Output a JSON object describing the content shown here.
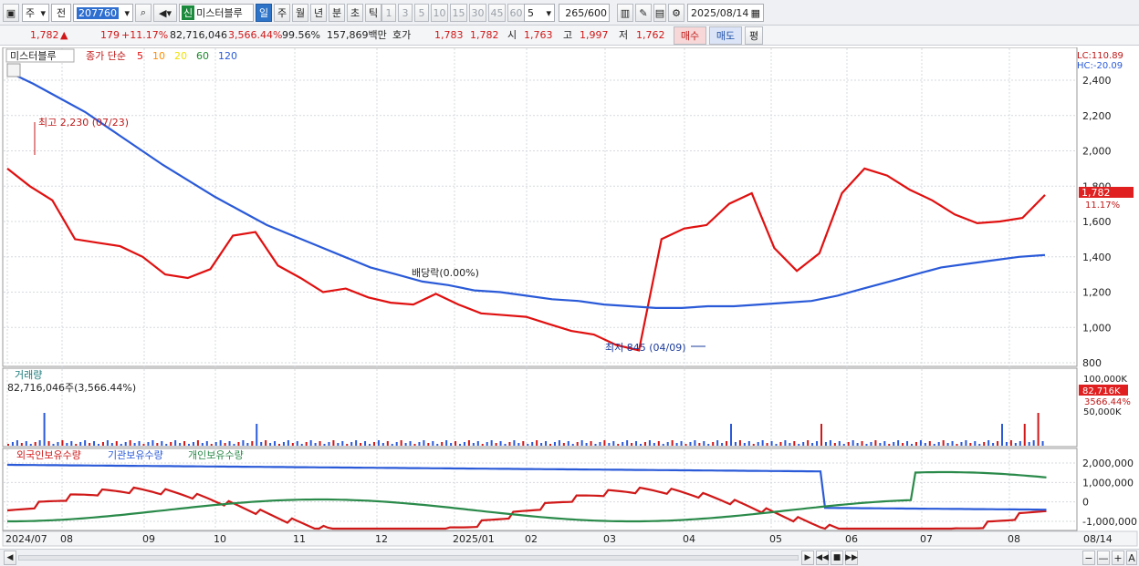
{
  "toolbar": {
    "market": "주",
    "mode": "전",
    "code": "207760",
    "stock_badge": "신",
    "stock_name": "미스터블루",
    "periods": [
      "일",
      "주",
      "월",
      "년",
      "분",
      "초",
      "틱"
    ],
    "active_period": "일",
    "intervals": [
      "1",
      "3",
      "5",
      "10",
      "15",
      "30",
      "45",
      "60"
    ],
    "interval_value": "5",
    "count": "265",
    "count_total": "/600",
    "date": "2025/08/14"
  },
  "infobar": {
    "price": "1,782",
    "arrow": "▲",
    "change": "179",
    "change_pct": "+11.17%",
    "volume": "82,716,046",
    "volume_pct": "3,566.44%",
    "ratio": "99.56%",
    "amount": "157,869백만",
    "hoga_label": "호가",
    "hoga_ask": "1,783",
    "hoga_bid": "1,782",
    "open_label": "시",
    "open": "1,763",
    "high_label": "고",
    "high": "1,997",
    "low_label": "저",
    "low": "1,762",
    "buy": "매수",
    "sell": "매도",
    "flat": "평"
  },
  "price_panel": {
    "name": "미스터블루",
    "ma_title": "종가 단순",
    "mas": [
      "5",
      "10",
      "20",
      "60",
      "120"
    ],
    "ma_colors": [
      "#e01010",
      "#ff8c00",
      "#f0e000",
      "#1a8a2a",
      "#2a5ad8"
    ],
    "lc": "LC:110.89",
    "hc": "HC:-20.09",
    "y_ticks": [
      "2,400",
      "2,200",
      "2,000",
      "1,800",
      "1,600",
      "1,400",
      "1,200",
      "1,000",
      "800"
    ],
    "high_note": "최고 2,230 (07/23)",
    "low_note": "최저 845 (04/09)",
    "dividend_note": "배당락(0.00%)",
    "cur_price": "1,782",
    "cur_pct": "11.17%"
  },
  "volume_panel": {
    "title": "거래량",
    "value": "82,716,046주(3,566.44%)",
    "y_ticks": [
      "100,000K",
      "50,000K"
    ],
    "cur_value": "82,716K",
    "cur_pct": "3566.44%"
  },
  "holding_panel": {
    "series": [
      "외국인보유수량",
      "기관보유수량",
      "개인보유수량"
    ],
    "series_colors": [
      "#d01818",
      "#2a5ad8",
      "#2a8a4a"
    ],
    "y_ticks": [
      "2,000,000",
      "1,000,000",
      "0",
      "-1,000,000"
    ]
  },
  "x_axis": [
    "2024/07",
    "08",
    "09",
    "10",
    "11",
    "12",
    "2025/01",
    "02",
    "03",
    "04",
    "05",
    "06",
    "07",
    "08",
    "08/14"
  ],
  "chart_data": {
    "type": "line",
    "price_range": [
      800,
      2400
    ],
    "price_series": [
      {
        "name": "5",
        "values": [
          1900,
          1800,
          1720,
          1500,
          1480,
          1460,
          1400,
          1300,
          1280,
          1330,
          1520,
          1540,
          1350,
          1280,
          1200,
          1220,
          1170,
          1140,
          1130,
          1190,
          1130,
          1080,
          1070,
          1060,
          1020,
          980,
          960,
          900,
          870,
          1500,
          1560,
          1580,
          1700,
          1760,
          1450,
          1320,
          1420,
          1760,
          1900,
          1860,
          1780,
          1720,
          1640,
          1590,
          1600,
          1620,
          1750
        ]
      },
      {
        "name": "120",
        "values": [
          2450,
          2380,
          2300,
          2220,
          2120,
          2020,
          1920,
          1830,
          1740,
          1660,
          1580,
          1520,
          1460,
          1400,
          1340,
          1300,
          1260,
          1240,
          1210,
          1200,
          1180,
          1160,
          1150,
          1130,
          1120,
          1110,
          1110,
          1120,
          1120,
          1130,
          1140,
          1150,
          1180,
          1220,
          1260,
          1300,
          1340,
          1360,
          1380,
          1400,
          1410
        ]
      }
    ],
    "volume_max_k": 100000,
    "holding_range": [
      -1000000,
      2000000
    ]
  }
}
